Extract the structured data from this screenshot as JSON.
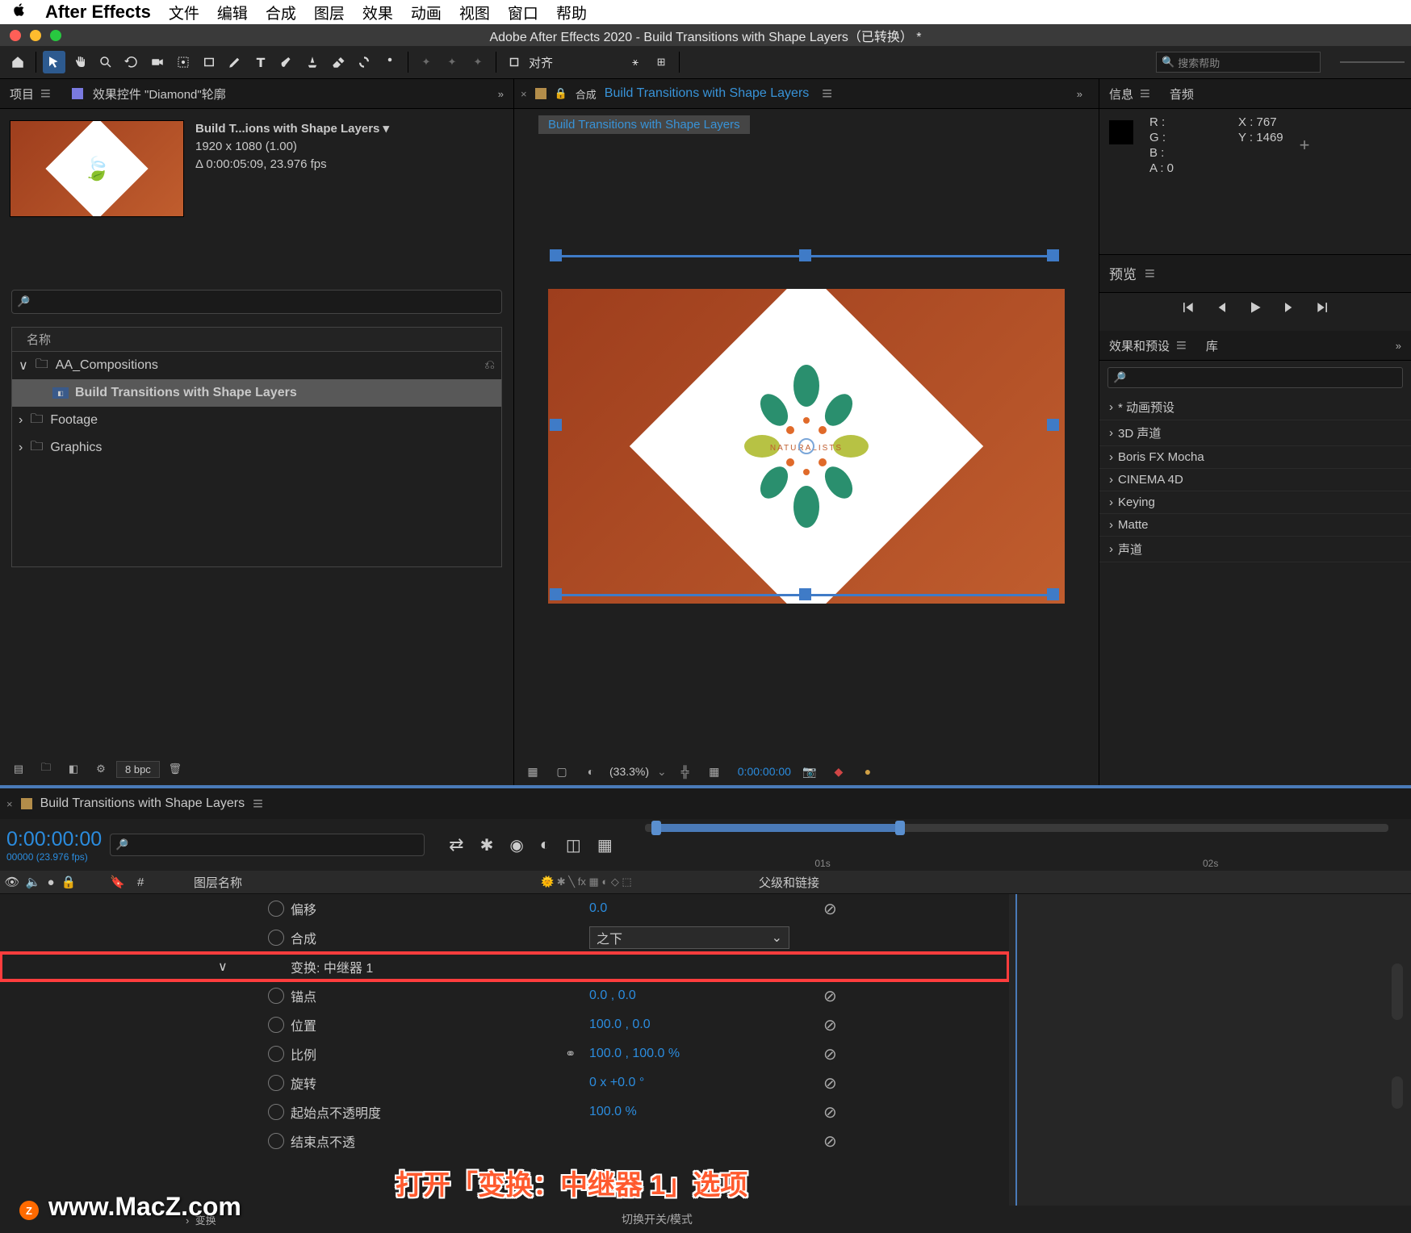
{
  "mac_menu": [
    "文件",
    "编辑",
    "合成",
    "图层",
    "效果",
    "动画",
    "视图",
    "窗口",
    "帮助"
  ],
  "app_name": "After Effects",
  "window_title": "Adobe After Effects 2020 - Build Transitions with Shape Layers（已转换） *",
  "toolbar": {
    "align_label": "对齐",
    "search_placeholder": "搜索帮助"
  },
  "project": {
    "tab_label": "项目",
    "fx_tab": "效果控件 \"Diamond\"轮廓",
    "comp_title": "Build T...ions with Shape Layers ▾",
    "comp_dims": "1920 x 1080 (1.00)",
    "comp_time": "Δ 0:00:05:09, 23.976 fps",
    "col_name": "名称",
    "folders": [
      "AA_Compositions",
      "Footage",
      "Graphics"
    ],
    "comp_item": "Build Transitions with Shape Layers",
    "bpc": "8 bpc"
  },
  "comp_panel": {
    "header_label": "合成",
    "tab_name": "Build Transitions with Shape Layers",
    "subtab": "Build Transitions with Shape Layers",
    "logo_text": "NATURALISTS",
    "zoom": "(33.3%)",
    "time": "0:00:00:00"
  },
  "info": {
    "tab_info": "信息",
    "tab_audio": "音频",
    "R": "R :",
    "G": "G :",
    "B": "B :",
    "A": "A :  0",
    "X": "X :  767",
    "Y": "Y :  1469",
    "preview_label": "预览"
  },
  "effects": {
    "tab_eff": "效果和预设",
    "tab_lib": "库",
    "items": [
      "* 动画预设",
      "3D 声道",
      "Boris FX Mocha",
      "CINEMA 4D",
      "Keying",
      "Matte",
      "声道"
    ]
  },
  "timeline": {
    "tab": "Build Transitions with Shape Layers",
    "timecode": "0:00:00:00",
    "sub": "00000 (23.976 fps)",
    "ruler_labels": [
      "01s",
      "02s"
    ],
    "col_eyes": "",
    "col_num": "#",
    "col_layername": "图层名称",
    "col_parent": "父级和链接",
    "switch_mode": "切换开关/模式",
    "props": [
      {
        "name": "偏移",
        "val": "0.0"
      },
      {
        "name": "合成",
        "val": "之下",
        "dropdown": true
      },
      {
        "name": "变换: 中继器 1",
        "val": "",
        "highlight": true,
        "expand": true,
        "nostop": true
      },
      {
        "name": "锚点",
        "val": "0.0 , 0.0"
      },
      {
        "name": "位置",
        "val": "100.0 , 0.0"
      },
      {
        "name": "比例",
        "val": "100.0 , 100.0 %",
        "chain": true
      },
      {
        "name": "旋转",
        "val": "0 x +0.0 °"
      },
      {
        "name": "起始点不透明度",
        "val": "100.0 %"
      },
      {
        "name": "结束点不透",
        "val": ""
      }
    ],
    "transform_label": "变换"
  },
  "annotation_text": "打开「变换：中继器 1」选项",
  "watermark": "www.MacZ.com",
  "z_badge": "Z"
}
